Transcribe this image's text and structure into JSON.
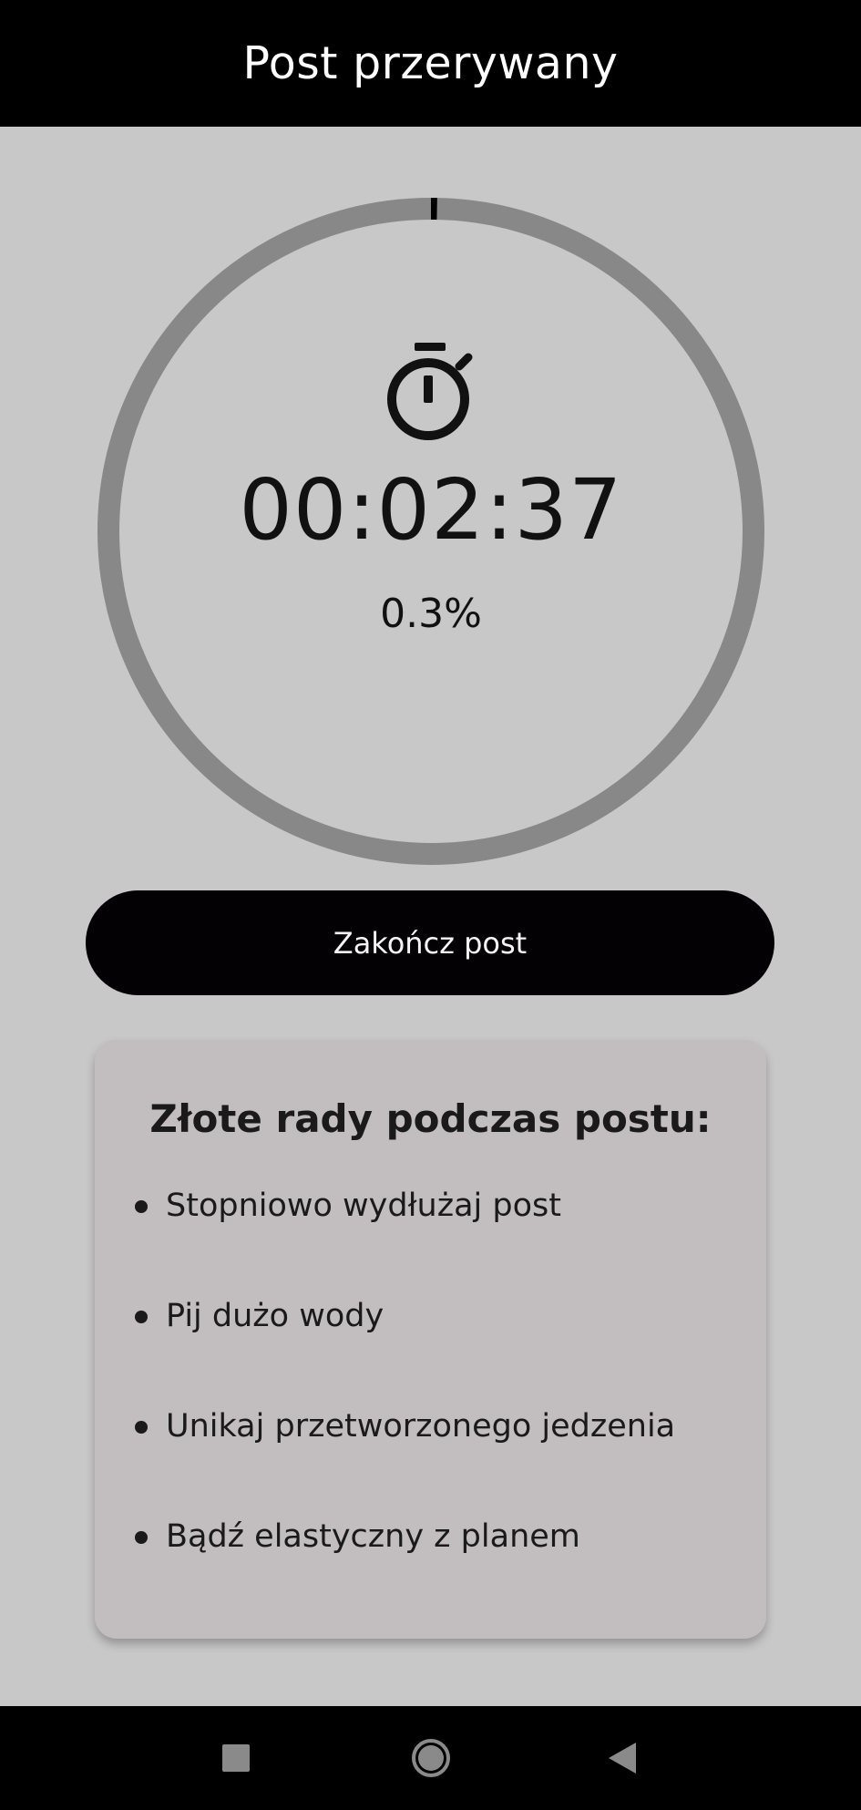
{
  "app": {
    "title": "Post przerywany"
  },
  "timer": {
    "elapsed": "00:02:37",
    "progress_label": "0.3%",
    "progress_fraction": 0.003
  },
  "actions": {
    "end_fast_label": "Zakończ post"
  },
  "tips": {
    "title": "Złote rady podczas postu:",
    "items": [
      "Stopniowo wydłużaj post",
      "Pij dużo wody",
      "Unikaj przetworzonego jedzenia",
      "Bądź elastyczny z planem"
    ]
  },
  "icons": {
    "timer": "stopwatch-icon",
    "nav_recent": "square-icon",
    "nav_home": "circle-icon",
    "nav_back": "triangle-back-icon"
  },
  "colors": {
    "background": "#c8c8c8",
    "top_bar": "#000000",
    "ring_track": "#888888",
    "ring_progress": "#000000",
    "button": "#040104",
    "card": "#c2bdbf"
  }
}
